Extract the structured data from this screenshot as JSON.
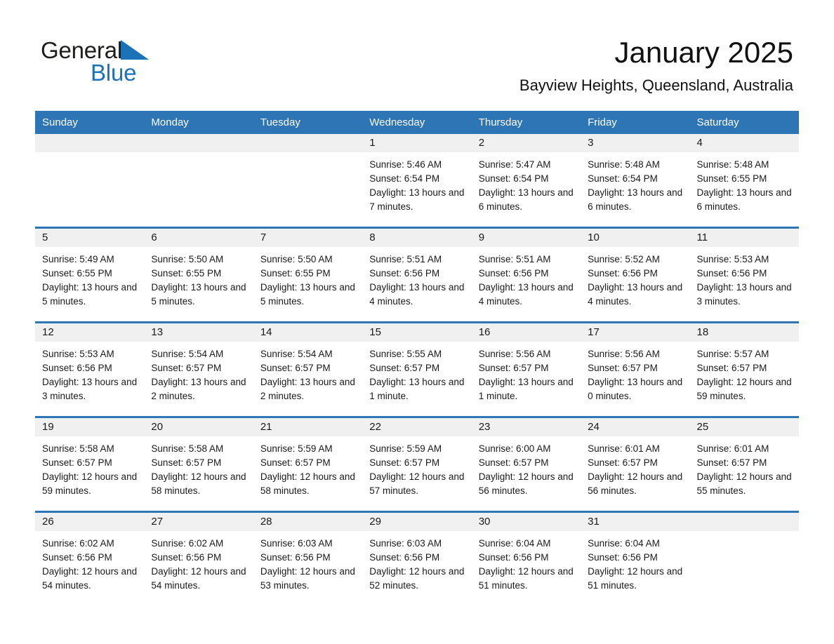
{
  "brand": {
    "name_part1": "General",
    "name_part2": "Blue",
    "triangle_color": "#1b72b8",
    "logo_icon": "triangle-logo-icon"
  },
  "header": {
    "month_title": "January 2025",
    "location": "Bayview Heights, Queensland, Australia"
  },
  "theme": {
    "header_blue": "#2e75b6",
    "daynum_band": "#f0f0f0",
    "text": "#1a1a1a"
  },
  "calendar": {
    "weekday_headers": [
      "Sunday",
      "Monday",
      "Tuesday",
      "Wednesday",
      "Thursday",
      "Friday",
      "Saturday"
    ],
    "weeks": [
      [
        {
          "day": "",
          "empty": true
        },
        {
          "day": "",
          "empty": true
        },
        {
          "day": "",
          "empty": true
        },
        {
          "day": "1",
          "sunrise": "Sunrise: 5:46 AM",
          "sunset": "Sunset: 6:54 PM",
          "daylight": "Daylight: 13 hours and 7 minutes."
        },
        {
          "day": "2",
          "sunrise": "Sunrise: 5:47 AM",
          "sunset": "Sunset: 6:54 PM",
          "daylight": "Daylight: 13 hours and 6 minutes."
        },
        {
          "day": "3",
          "sunrise": "Sunrise: 5:48 AM",
          "sunset": "Sunset: 6:54 PM",
          "daylight": "Daylight: 13 hours and 6 minutes."
        },
        {
          "day": "4",
          "sunrise": "Sunrise: 5:48 AM",
          "sunset": "Sunset: 6:55 PM",
          "daylight": "Daylight: 13 hours and 6 minutes."
        }
      ],
      [
        {
          "day": "5",
          "sunrise": "Sunrise: 5:49 AM",
          "sunset": "Sunset: 6:55 PM",
          "daylight": "Daylight: 13 hours and 5 minutes."
        },
        {
          "day": "6",
          "sunrise": "Sunrise: 5:50 AM",
          "sunset": "Sunset: 6:55 PM",
          "daylight": "Daylight: 13 hours and 5 minutes."
        },
        {
          "day": "7",
          "sunrise": "Sunrise: 5:50 AM",
          "sunset": "Sunset: 6:55 PM",
          "daylight": "Daylight: 13 hours and 5 minutes."
        },
        {
          "day": "8",
          "sunrise": "Sunrise: 5:51 AM",
          "sunset": "Sunset: 6:56 PM",
          "daylight": "Daylight: 13 hours and 4 minutes."
        },
        {
          "day": "9",
          "sunrise": "Sunrise: 5:51 AM",
          "sunset": "Sunset: 6:56 PM",
          "daylight": "Daylight: 13 hours and 4 minutes."
        },
        {
          "day": "10",
          "sunrise": "Sunrise: 5:52 AM",
          "sunset": "Sunset: 6:56 PM",
          "daylight": "Daylight: 13 hours and 4 minutes."
        },
        {
          "day": "11",
          "sunrise": "Sunrise: 5:53 AM",
          "sunset": "Sunset: 6:56 PM",
          "daylight": "Daylight: 13 hours and 3 minutes."
        }
      ],
      [
        {
          "day": "12",
          "sunrise": "Sunrise: 5:53 AM",
          "sunset": "Sunset: 6:56 PM",
          "daylight": "Daylight: 13 hours and 3 minutes."
        },
        {
          "day": "13",
          "sunrise": "Sunrise: 5:54 AM",
          "sunset": "Sunset: 6:57 PM",
          "daylight": "Daylight: 13 hours and 2 minutes."
        },
        {
          "day": "14",
          "sunrise": "Sunrise: 5:54 AM",
          "sunset": "Sunset: 6:57 PM",
          "daylight": "Daylight: 13 hours and 2 minutes."
        },
        {
          "day": "15",
          "sunrise": "Sunrise: 5:55 AM",
          "sunset": "Sunset: 6:57 PM",
          "daylight": "Daylight: 13 hours and 1 minute."
        },
        {
          "day": "16",
          "sunrise": "Sunrise: 5:56 AM",
          "sunset": "Sunset: 6:57 PM",
          "daylight": "Daylight: 13 hours and 1 minute."
        },
        {
          "day": "17",
          "sunrise": "Sunrise: 5:56 AM",
          "sunset": "Sunset: 6:57 PM",
          "daylight": "Daylight: 13 hours and 0 minutes."
        },
        {
          "day": "18",
          "sunrise": "Sunrise: 5:57 AM",
          "sunset": "Sunset: 6:57 PM",
          "daylight": "Daylight: 12 hours and 59 minutes."
        }
      ],
      [
        {
          "day": "19",
          "sunrise": "Sunrise: 5:58 AM",
          "sunset": "Sunset: 6:57 PM",
          "daylight": "Daylight: 12 hours and 59 minutes."
        },
        {
          "day": "20",
          "sunrise": "Sunrise: 5:58 AM",
          "sunset": "Sunset: 6:57 PM",
          "daylight": "Daylight: 12 hours and 58 minutes."
        },
        {
          "day": "21",
          "sunrise": "Sunrise: 5:59 AM",
          "sunset": "Sunset: 6:57 PM",
          "daylight": "Daylight: 12 hours and 58 minutes."
        },
        {
          "day": "22",
          "sunrise": "Sunrise: 5:59 AM",
          "sunset": "Sunset: 6:57 PM",
          "daylight": "Daylight: 12 hours and 57 minutes."
        },
        {
          "day": "23",
          "sunrise": "Sunrise: 6:00 AM",
          "sunset": "Sunset: 6:57 PM",
          "daylight": "Daylight: 12 hours and 56 minutes."
        },
        {
          "day": "24",
          "sunrise": "Sunrise: 6:01 AM",
          "sunset": "Sunset: 6:57 PM",
          "daylight": "Daylight: 12 hours and 56 minutes."
        },
        {
          "day": "25",
          "sunrise": "Sunrise: 6:01 AM",
          "sunset": "Sunset: 6:57 PM",
          "daylight": "Daylight: 12 hours and 55 minutes."
        }
      ],
      [
        {
          "day": "26",
          "sunrise": "Sunrise: 6:02 AM",
          "sunset": "Sunset: 6:56 PM",
          "daylight": "Daylight: 12 hours and 54 minutes."
        },
        {
          "day": "27",
          "sunrise": "Sunrise: 6:02 AM",
          "sunset": "Sunset: 6:56 PM",
          "daylight": "Daylight: 12 hours and 54 minutes."
        },
        {
          "day": "28",
          "sunrise": "Sunrise: 6:03 AM",
          "sunset": "Sunset: 6:56 PM",
          "daylight": "Daylight: 12 hours and 53 minutes."
        },
        {
          "day": "29",
          "sunrise": "Sunrise: 6:03 AM",
          "sunset": "Sunset: 6:56 PM",
          "daylight": "Daylight: 12 hours and 52 minutes."
        },
        {
          "day": "30",
          "sunrise": "Sunrise: 6:04 AM",
          "sunset": "Sunset: 6:56 PM",
          "daylight": "Daylight: 12 hours and 51 minutes."
        },
        {
          "day": "31",
          "sunrise": "Sunrise: 6:04 AM",
          "sunset": "Sunset: 6:56 PM",
          "daylight": "Daylight: 12 hours and 51 minutes."
        },
        {
          "day": "",
          "empty": true
        }
      ]
    ]
  }
}
